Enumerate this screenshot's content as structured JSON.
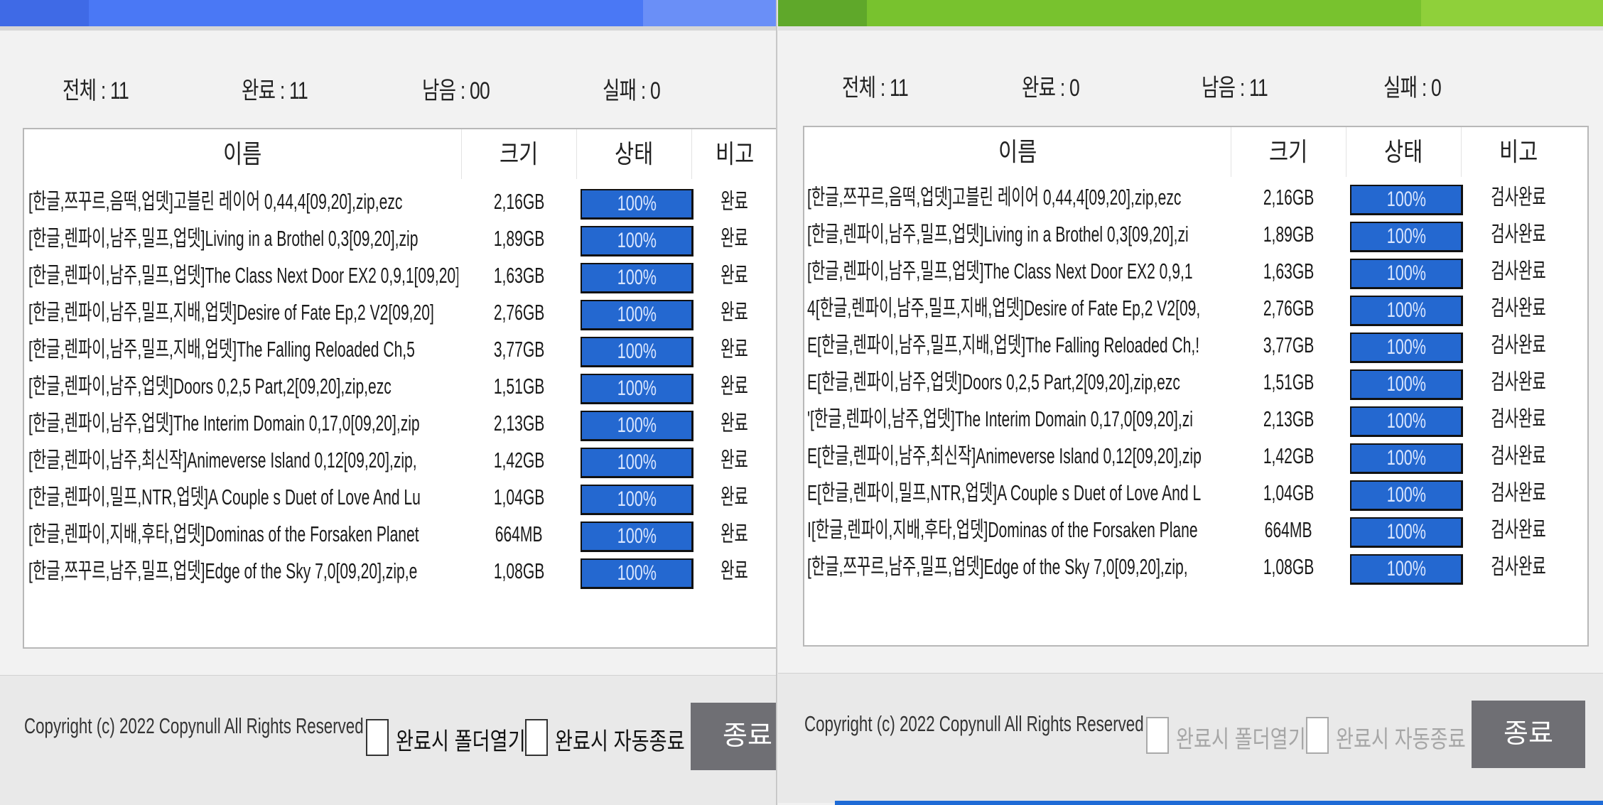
{
  "windows": [
    {
      "accent": "#4f7ff5",
      "stats": {
        "total": "전체 : 11",
        "done": "완료 : 11",
        "remain": "남음 : 00",
        "fail": "실패 : 0"
      },
      "columns": {
        "name": "이름",
        "size": "크기",
        "status": "상태",
        "note": "비고"
      },
      "rows": [
        {
          "name": "[한글,쯔꾸르,음떡,업뎃]고블린 레이어 0,44,4[09,20],zip,ezc",
          "size": "2,16GB",
          "progress": "100%",
          "note": "완료"
        },
        {
          "name": "[한글,렌파이,남주,밀프,업뎃]Living in a Brothel 0,3[09,20],zip",
          "size": "1,89GB",
          "progress": "100%",
          "note": "완료"
        },
        {
          "name": "[한글,렌파이,남주,밀프,업뎃]The Class Next Door EX2 0,9,1[09,20]",
          "size": "1,63GB",
          "progress": "100%",
          "note": "완료"
        },
        {
          "name": "[한글,렌파이,남주,밀프,지배,업뎃]Desire of Fate Ep,2 V2[09,20]",
          "size": "2,76GB",
          "progress": "100%",
          "note": "완료"
        },
        {
          "name": "[한글,렌파이,남주,밀프,지배,업뎃]The Falling Reloaded Ch,5",
          "size": "3,77GB",
          "progress": "100%",
          "note": "완료"
        },
        {
          "name": "[한글,렌파이,남주,업뎃]Doors 0,2,5 Part,2[09,20],zip,ezc",
          "size": "1,51GB",
          "progress": "100%",
          "note": "완료"
        },
        {
          "name": "[한글,렌파이,남주,업뎃]The Interim Domain 0,17,0[09,20],zip",
          "size": "2,13GB",
          "progress": "100%",
          "note": "완료"
        },
        {
          "name": "[한글,렌파이,남주,최신작]Animeverse Island 0,12[09,20],zip,",
          "size": "1,42GB",
          "progress": "100%",
          "note": "완료"
        },
        {
          "name": "[한글,렌파이,밀프,NTR,업뎃]A Couple s Duet of Love And Lu",
          "size": "1,04GB",
          "progress": "100%",
          "note": "완료"
        },
        {
          "name": "[한글,렌파이,지배,후타,업뎃]Dominas of the Forsaken Planet",
          "size": "664MB",
          "progress": "100%",
          "note": "완료"
        },
        {
          "name": "[한글,쯔꾸르,남주,밀프,업뎃]Edge of the Sky 7,0[09,20],zip,e",
          "size": "1,08GB",
          "progress": "100%",
          "note": "완료"
        }
      ],
      "footer": {
        "copyright": "Copyright (c) 2022 Copynull All Rights Reserved",
        "open_folder": "완료시 폴더열기",
        "auto_exit": "완료시 자동종료",
        "exit": "종료"
      }
    },
    {
      "accent": "#72c22c",
      "stats": {
        "total": "전체 : 11",
        "done": "완료 : 0",
        "remain": "남음 : 11",
        "fail": "실패 : 0"
      },
      "columns": {
        "name": "이름",
        "size": "크기",
        "status": "상태",
        "note": "비고"
      },
      "rows": [
        {
          "name": "[한글,쯔꾸르,음떡,업뎃]고블린 레이어 0,44,4[09,20],zip,ezc",
          "size": "2,16GB",
          "progress": "100%",
          "note": "검사완료"
        },
        {
          "name": "[한글,렌파이,남주,밀프,업뎃]Living in a Brothel 0,3[09,20],zi",
          "size": "1,89GB",
          "progress": "100%",
          "note": "검사완료"
        },
        {
          "name": "[한글,렌파이,남주,밀프,업뎃]The Class Next Door EX2 0,9,1",
          "size": "1,63GB",
          "progress": "100%",
          "note": "검사완료"
        },
        {
          "name": "4[한글,렌파이,남주,밀프,지배,업뎃]Desire of Fate Ep,2 V2[09,",
          "size": "2,76GB",
          "progress": "100%",
          "note": "검사완료"
        },
        {
          "name": "E[한글,렌파이,남주,밀프,지배,업뎃]The Falling Reloaded Ch,!",
          "size": "3,77GB",
          "progress": "100%",
          "note": "검사완료"
        },
        {
          "name": "E[한글,렌파이,남주,업뎃]Doors 0,2,5 Part,2[09,20],zip,ezc",
          "size": "1,51GB",
          "progress": "100%",
          "note": "검사완료"
        },
        {
          "name": "'[한글,렌파이,남주,업뎃]The Interim Domain 0,17,0[09,20],zi",
          "size": "2,13GB",
          "progress": "100%",
          "note": "검사완료"
        },
        {
          "name": "E[한글,렌파이,남주,최신작]Animeverse Island 0,12[09,20],zip",
          "size": "1,42GB",
          "progress": "100%",
          "note": "검사완료"
        },
        {
          "name": "E[한글,렌파이,밀프,NTR,업뎃]A Couple s Duet of Love And L",
          "size": "1,04GB",
          "progress": "100%",
          "note": "검사완료"
        },
        {
          "name": "I[한글,렌파이,지배,후타,업뎃]Dominas of the Forsaken Plane",
          "size": "664MB",
          "progress": "100%",
          "note": "검사완료"
        },
        {
          "name": "[한글,쯔꾸르,남주,밀프,업뎃]Edge of the Sky 7,0[09,20],zip,",
          "size": "1,08GB",
          "progress": "100%",
          "note": "검사완료"
        }
      ],
      "footer": {
        "copyright": "Copyright (c) 2022 Copynull All Rights Reserved",
        "open_folder": "완료시 폴더열기",
        "auto_exit": "완료시 자동종료",
        "exit": "종료"
      }
    }
  ]
}
